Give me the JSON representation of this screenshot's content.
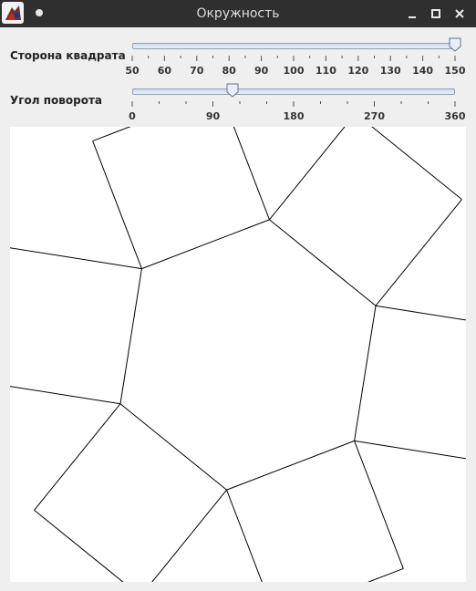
{
  "window": {
    "title": "Окружность",
    "controls": [
      "minimize-icon",
      "maximize-icon",
      "close-icon"
    ]
  },
  "side_slider": {
    "label": "Сторона квадрата",
    "min": 50,
    "max": 150,
    "value": 150,
    "tick_labels": [
      "50",
      "60",
      "70",
      "80",
      "90",
      "100",
      "110",
      "120",
      "130",
      "140",
      "150"
    ]
  },
  "angle_slider": {
    "label": "Угол поворота",
    "min": 0,
    "max": 360,
    "value": 112,
    "tick_labels": [
      "0",
      "90",
      "180",
      "270",
      "360"
    ]
  },
  "colors": {
    "titlebar": "#2f2f2f",
    "canvas": "#ffffff",
    "stroke": "#000000"
  }
}
